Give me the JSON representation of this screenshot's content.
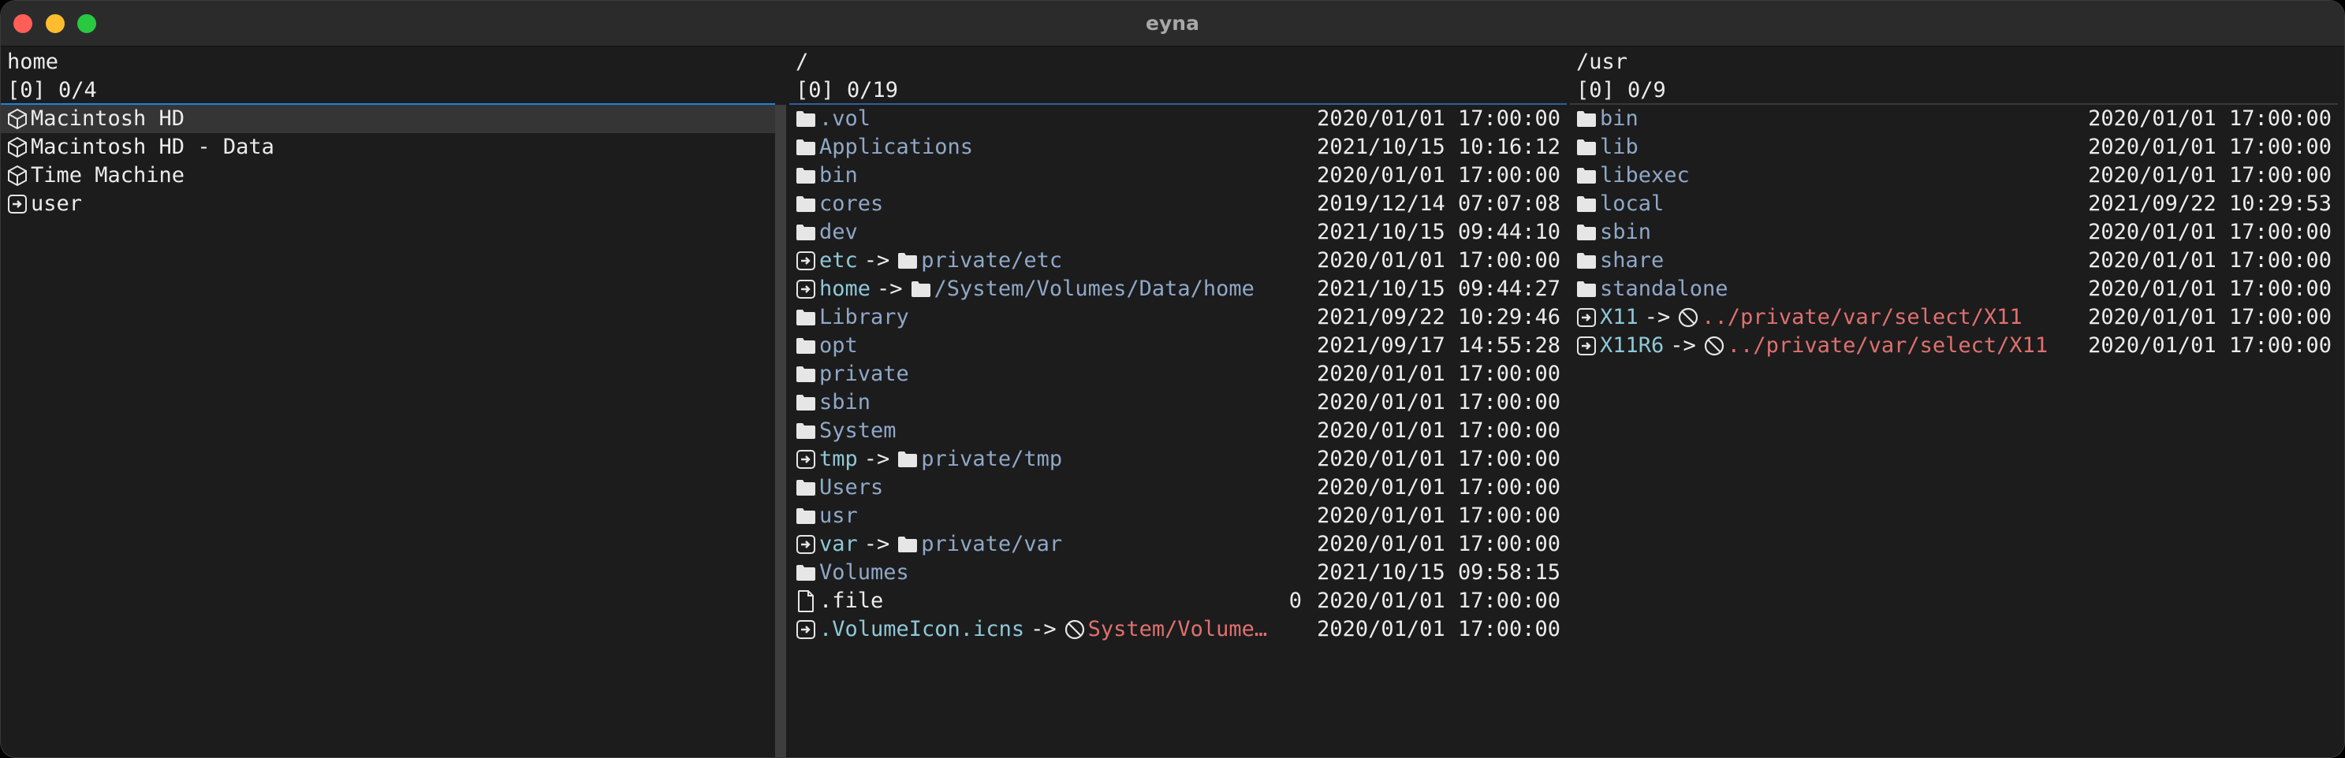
{
  "window": {
    "title": "eyna"
  },
  "panes": {
    "home": {
      "path": "home",
      "status": "[0] 0/4",
      "items": [
        {
          "icon": "volume-icon",
          "name": "Macintosh HD"
        },
        {
          "icon": "volume-icon",
          "name": "Macintosh HD - Data"
        },
        {
          "icon": "volume-icon",
          "name": "Time Machine"
        },
        {
          "icon": "symlink-icon",
          "name": "user"
        }
      ]
    },
    "root": {
      "path": "/",
      "status": "[0] 0/19",
      "items": [
        {
          "icon": "folder-icon",
          "name": ".vol",
          "date": "2020/01/01 17:00:00"
        },
        {
          "icon": "folder-icon",
          "name": "Applications",
          "date": "2021/10/15 10:16:12"
        },
        {
          "icon": "folder-icon",
          "name": "bin",
          "date": "2020/01/01 17:00:00"
        },
        {
          "icon": "folder-icon",
          "name": "cores",
          "date": "2019/12/14 07:07:08"
        },
        {
          "icon": "folder-icon",
          "name": "dev",
          "date": "2021/10/15 09:44:10"
        },
        {
          "icon": "symlink-icon",
          "name": "etc",
          "arrow": "->",
          "target_icon": "folder-icon",
          "target": "private/etc",
          "date": "2020/01/01 17:00:00"
        },
        {
          "icon": "symlink-icon",
          "name": "home",
          "arrow": "->",
          "target_icon": "folder-icon",
          "target": "/System/Volumes/Data/home",
          "date": "2021/10/15 09:44:27"
        },
        {
          "icon": "folder-icon",
          "name": "Library",
          "date": "2021/09/22 10:29:46"
        },
        {
          "icon": "folder-icon",
          "name": "opt",
          "date": "2021/09/17 14:55:28"
        },
        {
          "icon": "folder-icon",
          "name": "private",
          "date": "2020/01/01 17:00:00"
        },
        {
          "icon": "folder-icon",
          "name": "sbin",
          "date": "2020/01/01 17:00:00"
        },
        {
          "icon": "folder-icon",
          "name": "System",
          "date": "2020/01/01 17:00:00"
        },
        {
          "icon": "symlink-icon",
          "name": "tmp",
          "arrow": "->",
          "target_icon": "folder-icon",
          "target": "private/tmp",
          "date": "2020/01/01 17:00:00"
        },
        {
          "icon": "folder-icon",
          "name": "Users",
          "date": "2020/01/01 17:00:00"
        },
        {
          "icon": "folder-icon",
          "name": "usr",
          "date": "2020/01/01 17:00:00"
        },
        {
          "icon": "symlink-icon",
          "name": "var",
          "arrow": "->",
          "target_icon": "folder-icon",
          "target": "private/var",
          "date": "2020/01/01 17:00:00"
        },
        {
          "icon": "folder-icon",
          "name": "Volumes",
          "date": "2021/10/15 09:58:15"
        },
        {
          "icon": "file-icon",
          "name": ".file",
          "size": "0",
          "date": "2020/01/01 17:00:00"
        },
        {
          "icon": "symlink-icon",
          "name": ".VolumeIcon.icns",
          "arrow": "->",
          "target_icon": "broken-link-icon",
          "target": "System/Volume…",
          "date": "2020/01/01 17:00:00"
        }
      ]
    },
    "usr": {
      "path": "/usr",
      "status": "[0] 0/9",
      "items": [
        {
          "icon": "folder-icon",
          "name": "bin",
          "date": "2020/01/01 17:00:00"
        },
        {
          "icon": "folder-icon",
          "name": "lib",
          "date": "2020/01/01 17:00:00"
        },
        {
          "icon": "folder-icon",
          "name": "libexec",
          "date": "2020/01/01 17:00:00"
        },
        {
          "icon": "folder-icon",
          "name": "local",
          "date": "2021/09/22 10:29:53"
        },
        {
          "icon": "folder-icon",
          "name": "sbin",
          "date": "2020/01/01 17:00:00"
        },
        {
          "icon": "folder-icon",
          "name": "share",
          "date": "2020/01/01 17:00:00"
        },
        {
          "icon": "folder-icon",
          "name": "standalone",
          "date": "2020/01/01 17:00:00"
        },
        {
          "icon": "symlink-icon",
          "name": "X11",
          "arrow": "->",
          "target_icon": "broken-link-icon",
          "target": "../private/var/select/X11",
          "date": "2020/01/01 17:00:00"
        },
        {
          "icon": "symlink-icon",
          "name": "X11R6",
          "arrow": "->",
          "target_icon": "broken-link-icon",
          "target": "../private/var/select/X11",
          "date": "2020/01/01 17:00:00"
        }
      ]
    }
  },
  "colors": {
    "directory": "#8fa8c8",
    "link": "#8fc8d8",
    "broken": "#e07070",
    "active_separator": "#1e82dc"
  }
}
